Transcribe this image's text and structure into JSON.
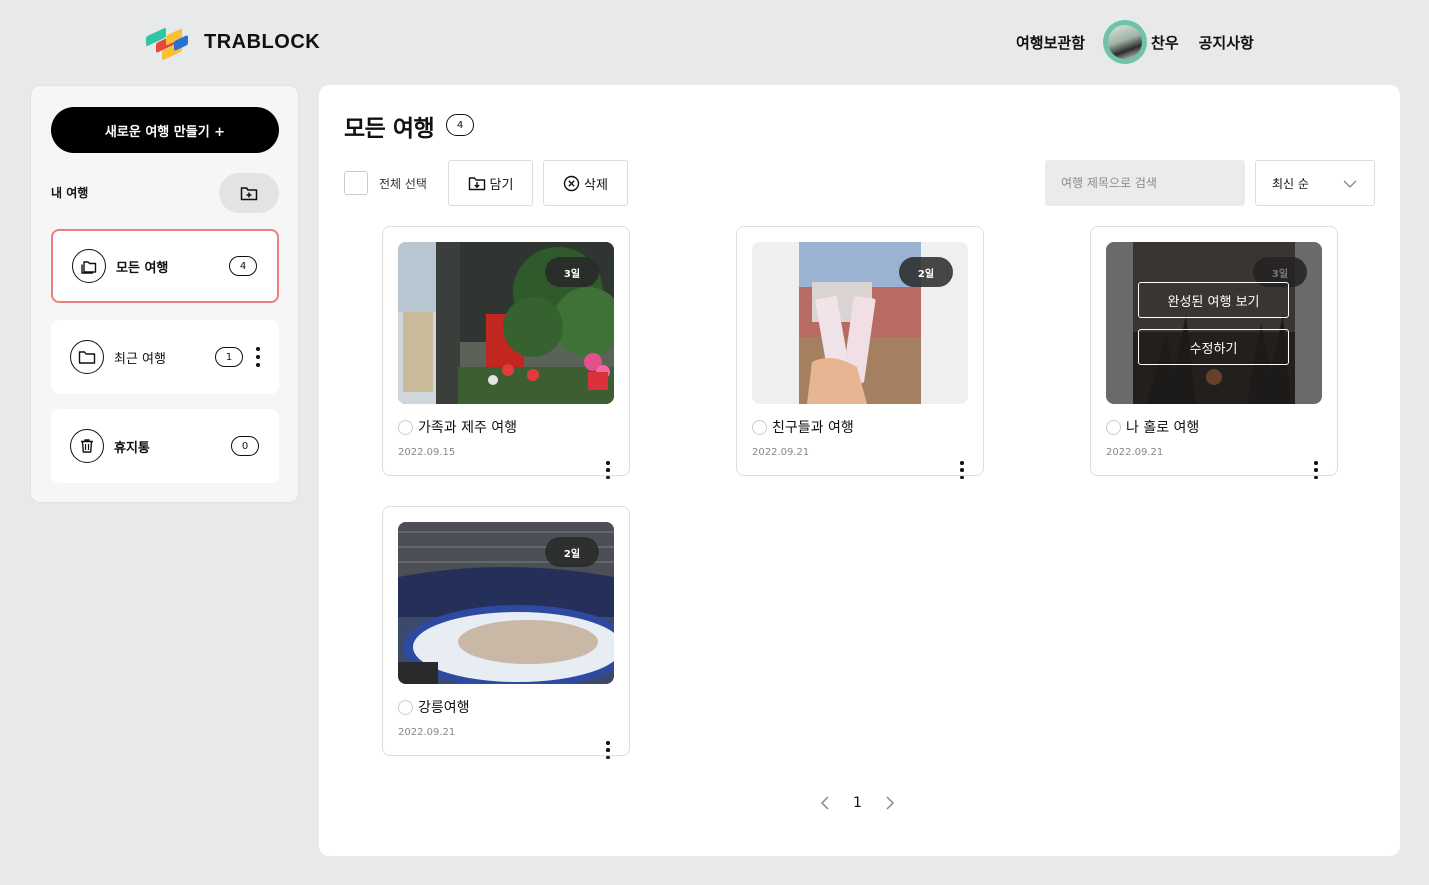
{
  "header": {
    "logo_text": "TRABLOCK",
    "nav": {
      "archive": "여행보관함",
      "user_name": "찬우",
      "notice": "공지사항"
    }
  },
  "sidebar": {
    "new_trip_label": "새로운 여행 만들기 +",
    "section_label": "내 여행",
    "folders": [
      {
        "label": "모든 여행",
        "count": "4"
      },
      {
        "label": "최근 여행",
        "count": "1"
      },
      {
        "label": "휴지통",
        "count": "0"
      }
    ]
  },
  "main": {
    "title": "모든 여행",
    "count": "4",
    "toolbar": {
      "select_all": "전체 선택",
      "save": "담기",
      "delete": "삭제",
      "search_placeholder": "여행 제목으로 검색",
      "sort": "최신 순"
    },
    "trips": [
      {
        "title": "가족과 제주 여행",
        "date": "2022.09.15",
        "days": "3일"
      },
      {
        "title": "친구들과 여행",
        "date": "2022.09.21",
        "days": "2일"
      },
      {
        "title": "나 홀로 여행",
        "date": "2022.09.21",
        "days": "3일",
        "hover_actions": [
          "완성된 여행 보기",
          "수정하기"
        ]
      },
      {
        "title": "강릉여행",
        "date": "2022.09.21",
        "days": "2일"
      }
    ],
    "pagination": {
      "current": "1"
    }
  },
  "colors": {
    "accent_border": "#e9807f",
    "avatar_ring": "#6fc3a8",
    "primary_button": "#000000"
  }
}
